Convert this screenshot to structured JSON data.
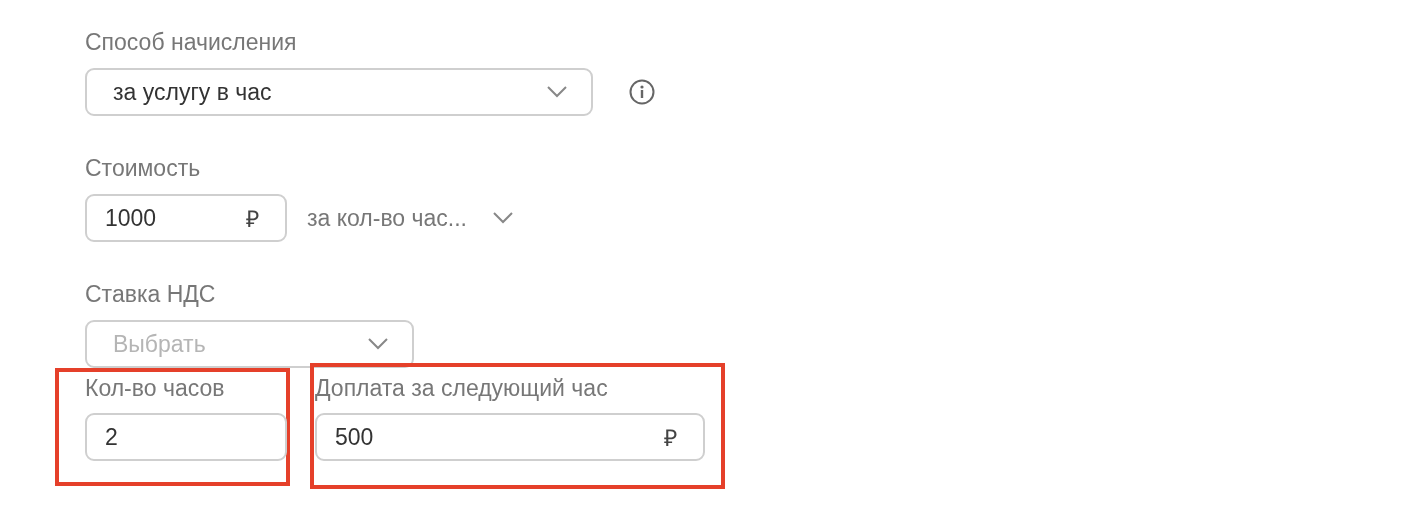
{
  "method": {
    "label": "Способ начисления",
    "value": "за услугу в час",
    "info": true
  },
  "cost": {
    "label": "Стоимость",
    "value": "1000",
    "currency": "₽",
    "unit": "за кол-во час..."
  },
  "vat": {
    "label": "Ставка НДС",
    "placeholder": "Выбрать"
  },
  "hours": {
    "label": "Кол-во часов",
    "value": "2",
    "highlighted": true
  },
  "surcharge": {
    "label": "Доплата за следующий час",
    "value": "500",
    "currency": "₽",
    "highlighted": true
  }
}
